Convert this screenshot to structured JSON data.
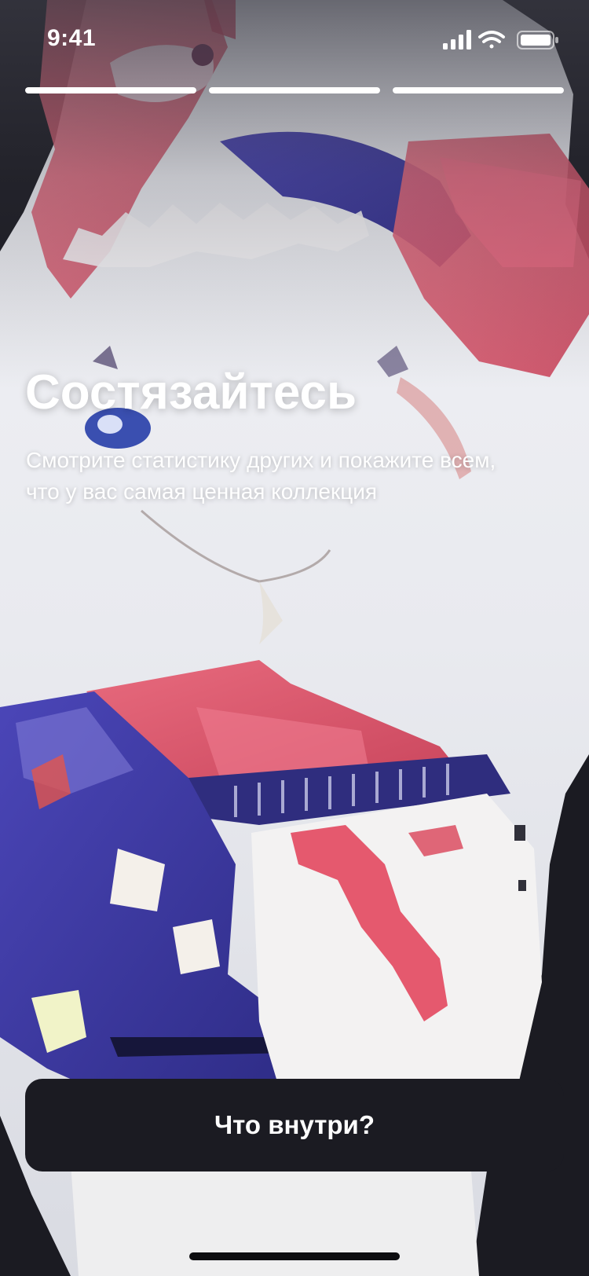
{
  "status_bar": {
    "time": "9:41",
    "icons": [
      "cellular-signal-icon",
      "wifi-icon",
      "battery-icon"
    ]
  },
  "progress": {
    "total_steps": 3,
    "segments": [
      {
        "fill": 1.0
      },
      {
        "fill": 1.0
      },
      {
        "fill": 1.0
      }
    ]
  },
  "onboarding": {
    "title": "Состязайтесь",
    "subtitle_line1": "Смотрите статистику других и покажите всем,",
    "subtitle_line2": "что у вас самая ценная коллекция"
  },
  "cta": {
    "label": "Что внутри?"
  },
  "colors": {
    "background": "#1b1b22",
    "button_background": "#1b1b22",
    "text": "#ffffff",
    "accent_pink": "#e0566f",
    "accent_blue": "#3f3fa6"
  }
}
